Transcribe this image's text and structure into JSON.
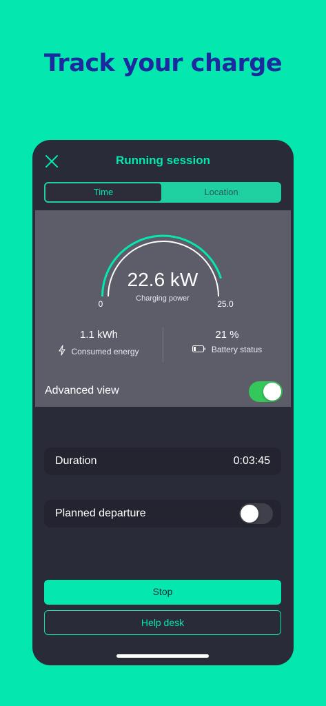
{
  "headline": "Track your charge",
  "nav": {
    "title": "Running session",
    "close_icon": "close-icon"
  },
  "tabs": [
    {
      "label": "Time",
      "active": true
    },
    {
      "label": "Location",
      "active": false
    }
  ],
  "gauge": {
    "value": "22.6 kW",
    "label": "Charging power",
    "min": "0",
    "max": "25.0",
    "fraction": 0.904,
    "accent": "#04e8b0"
  },
  "stats": {
    "energy": {
      "value": "1.1 kWh",
      "label": "Consumed energy",
      "icon": "bolt-icon"
    },
    "battery": {
      "value": "21 %",
      "label": "Battery status",
      "icon": "battery-icon"
    }
  },
  "advanced_view": {
    "label": "Advanced view",
    "on": true
  },
  "duration": {
    "label": "Duration",
    "value": "0:03:45"
  },
  "planned_departure": {
    "label": "Planned departure",
    "on": false
  },
  "buttons": {
    "stop": "Stop",
    "help": "Help desk"
  },
  "colors": {
    "background": "#04e8b0",
    "headline": "#1b2a9e",
    "phone": "#2a2b38",
    "panel": "#5c5d69",
    "toggle_on": "#34c759"
  }
}
